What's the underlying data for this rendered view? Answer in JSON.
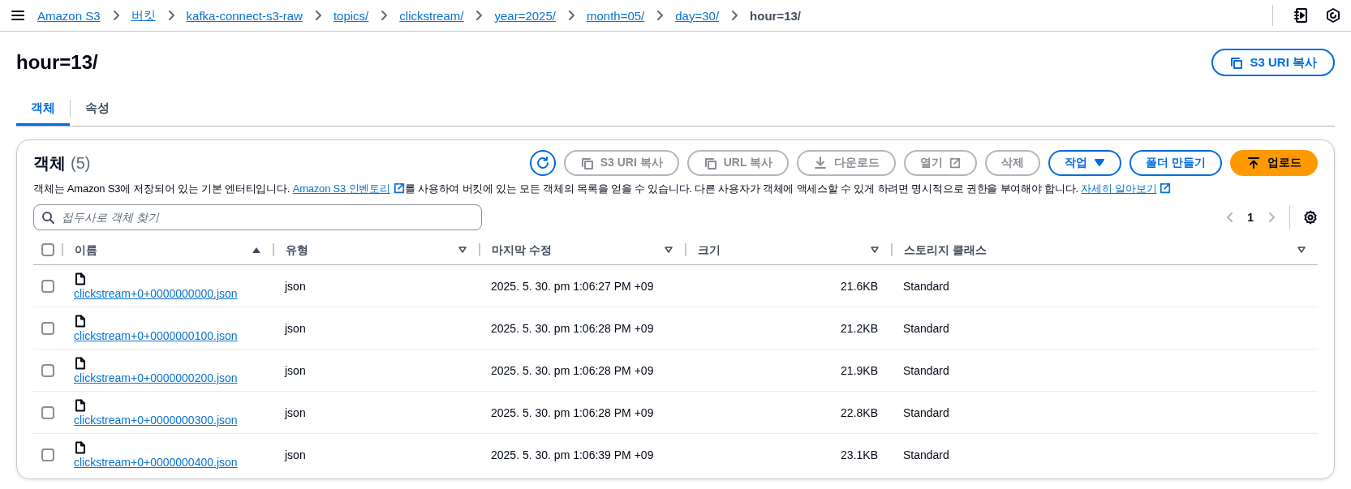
{
  "top_bar": {
    "breadcrumbs": [
      {
        "label": "Amazon S3",
        "current": false
      },
      {
        "label": "버킷",
        "current": false
      },
      {
        "label": "kafka-connect-s3-raw",
        "current": false
      },
      {
        "label": "topics/",
        "current": false
      },
      {
        "label": "clickstream/",
        "current": false
      },
      {
        "label": "year=2025/",
        "current": false
      },
      {
        "label": "month=05/",
        "current": false
      },
      {
        "label": "day=30/",
        "current": false
      },
      {
        "label": "hour=13/",
        "current": true
      }
    ]
  },
  "header": {
    "title": "hour=13/",
    "copy_button": "S3 URI 복사"
  },
  "tabs": [
    {
      "label": "객체",
      "selected": true
    },
    {
      "label": "속성",
      "selected": false
    }
  ],
  "objects": {
    "title": "객체",
    "count": "(5)",
    "actions": [
      {
        "kind": "refresh",
        "disabled": false
      },
      {
        "kind": "copy",
        "label": "S3 URI 복사",
        "disabled": true
      },
      {
        "kind": "copy",
        "label": "URL 복사",
        "disabled": true
      },
      {
        "kind": "download",
        "label": "다운로드",
        "disabled": true
      },
      {
        "kind": "external",
        "label": "열기",
        "disabled": true
      },
      {
        "kind": "plain",
        "label": "삭제",
        "disabled": true
      },
      {
        "kind": "dropdown",
        "label": "작업",
        "disabled": false
      },
      {
        "kind": "plain",
        "label": "폴더 만들기",
        "disabled": false
      },
      {
        "kind": "upload",
        "label": "업로드",
        "disabled": false
      }
    ],
    "description": [
      {
        "kind": "text",
        "text": "객체는 Amazon S3에 저장되어 있는 기본 엔터티입니다. "
      },
      {
        "kind": "external-link",
        "text": "Amazon S3 인벤토리"
      },
      {
        "kind": "text",
        "text": "를 사용하여 버킷에 있는 모든 객체의 목록을 얻을 수 있습니다. 다른 사용자가 객체에 액세스할 수 있게 하려면 명시적으로 권한을 부여해야 합니다. "
      },
      {
        "kind": "external-link",
        "text": "자세히 알아보기"
      }
    ],
    "search": {
      "placeholder": "접두사로 객체 찾기"
    },
    "pagination": {
      "page": "1",
      "prev_disabled": true,
      "next_disabled": true
    }
  },
  "table": {
    "select_all": false,
    "columns": [
      {
        "label": "이름",
        "sorted": true
      },
      {
        "label": "유형",
        "sorted": false
      },
      {
        "label": "마지막 수정",
        "sorted": false
      },
      {
        "label": "크기",
        "sorted": false
      },
      {
        "label": "스토리지 클래스",
        "sorted": false
      }
    ],
    "rows": [
      {
        "checked": false,
        "name": "clickstream+0+0000000000.json",
        "type": "json",
        "modified": "2025. 5. 30. pm 1:06:27 PM +09",
        "size": "21.6KB",
        "storage_class": "Standard"
      },
      {
        "checked": false,
        "name": "clickstream+0+0000000100.json",
        "type": "json",
        "modified": "2025. 5. 30. pm 1:06:28 PM +09",
        "size": "21.2KB",
        "storage_class": "Standard"
      },
      {
        "checked": false,
        "name": "clickstream+0+0000000200.json",
        "type": "json",
        "modified": "2025. 5. 30. pm 1:06:28 PM +09",
        "size": "21.9KB",
        "storage_class": "Standard"
      },
      {
        "checked": false,
        "name": "clickstream+0+0000000300.json",
        "type": "json",
        "modified": "2025. 5. 30. pm 1:06:28 PM +09",
        "size": "22.8KB",
        "storage_class": "Standard"
      },
      {
        "checked": false,
        "name": "clickstream+0+0000000400.json",
        "type": "json",
        "modified": "2025. 5. 30. pm 1:06:39 PM +09",
        "size": "23.1KB",
        "storage_class": "Standard"
      }
    ]
  }
}
